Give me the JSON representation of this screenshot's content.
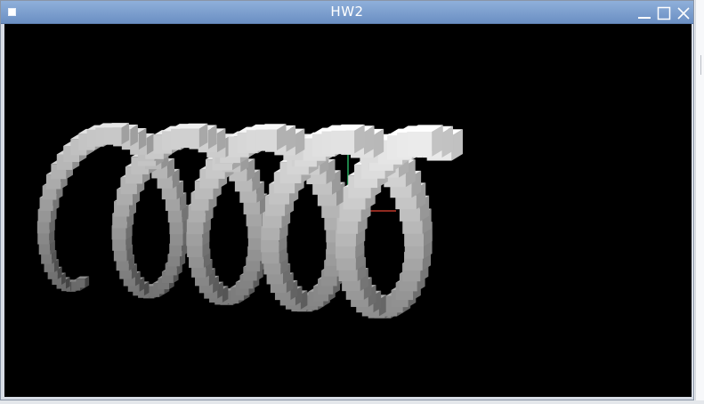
{
  "window": {
    "title": "HW2",
    "controls": [
      "minimize-icon",
      "maximize-icon",
      "close-icon"
    ]
  },
  "viewport": {
    "background": "#000000",
    "cube_color": "#bdbdbd",
    "axes": {
      "x_color": "#c0392b",
      "y_color": "#27ae60",
      "z_color": "#2e3fbf"
    }
  }
}
